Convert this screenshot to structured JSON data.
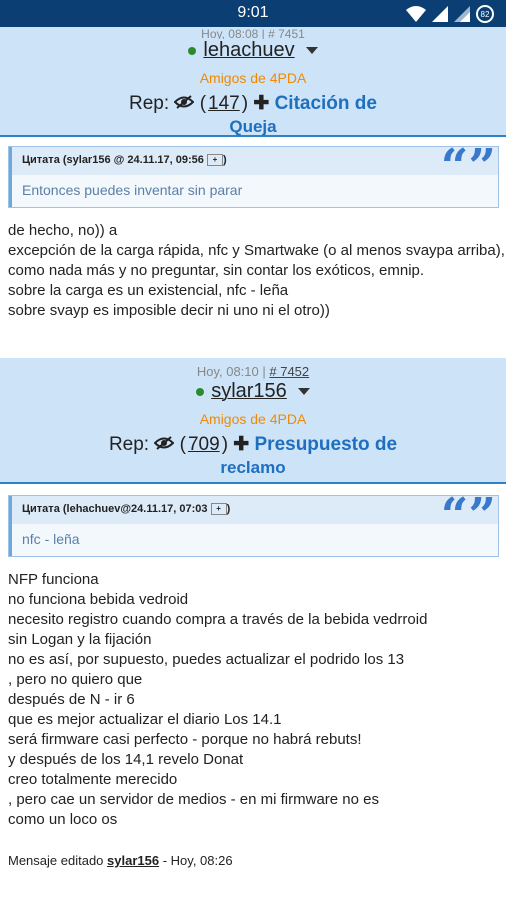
{
  "status": {
    "time": "9:01",
    "battery": "82"
  },
  "post1": {
    "meta": "Hoy, 08:08 | # 7451",
    "username": "lehachuev",
    "group": "Amigos de 4PDA",
    "rep_label": "Rep:",
    "rep_count": "147",
    "rep_link": "Citación de",
    "reclaim": "Queja"
  },
  "quote1": {
    "header": "Цитата (sylar156 @ 24.11.17, 09:56",
    "text": "Entonces puedes inventar sin parar"
  },
  "body1": [
    "de hecho, no)) a",
    "excepción de la carga rápida, nfc y Smartwake (o al menos svaypa arriba),",
    "como nada más y no preguntar, sin contar los exóticos, emnip.",
    "sobre la carga es un existencial, nfc - leña",
    "sobre svayp es imposible decir ni uno ni el otro))"
  ],
  "post2": {
    "meta_date": "Hoy, 08:10",
    "meta_num": "# 7452",
    "username": "sylar156",
    "group": "Amigos de 4PDA",
    "rep_label": "Rep:",
    "rep_count": "709",
    "rep_link": "Presupuesto de",
    "reclaim": "reclamo"
  },
  "quote2": {
    "header": "Цитата (lehachuev@24.11.17, 07:03",
    "text": "nfc - leña"
  },
  "body2": [
    "NFP funciona",
    "no funciona bebida vedroid",
    "necesito registro cuando compra a través de la bebida vedrroid",
    "sin Logan y la fijación",
    "no es así, por supuesto, puedes actualizar el podrido los 13",
    ", pero no quiero que",
    "después de N - ir 6",
    "que es mejor actualizar el diario Los 14.1",
    "será firmware casi perfecto - porque no habrá rebuts!",
    "y después de los 14,1 revelo Donat",
    "creo totalmente merecido",
    ", pero cae un servidor de medios - en mi firmware no es",
    "como un loco os"
  ],
  "edited": {
    "prefix": "Mensaje editado",
    "user": "sylar156",
    "suffix": "- Hoy, 08:26"
  }
}
